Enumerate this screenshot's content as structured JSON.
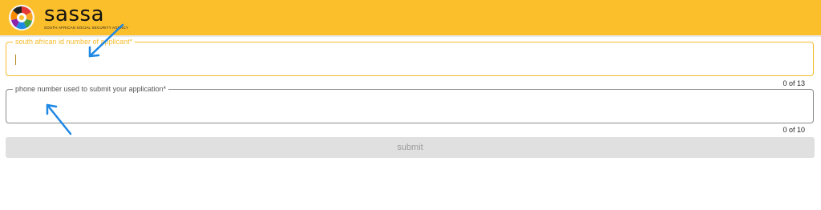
{
  "header": {
    "brand_name": "sassa",
    "brand_tagline": "SOUTH AFRICAN SOCIAL SECURITY AGENCY",
    "logo_icon": "sassa-emblem-icon"
  },
  "form": {
    "id_field": {
      "label": "south african id number of applicant*",
      "value": "",
      "counter": "0 of 13"
    },
    "phone_field": {
      "label": "phone number used to submit your application*",
      "value": "",
      "counter": "0 of 10"
    },
    "submit_label": "submit"
  },
  "annotations": {
    "arrow_icon": "arrow-icon",
    "arrow_color": "#1e88e5"
  },
  "colors": {
    "header_bg": "#fbbf2c",
    "focus_border": "#f6bb2e",
    "disabled_button": "#e0e0e0"
  }
}
